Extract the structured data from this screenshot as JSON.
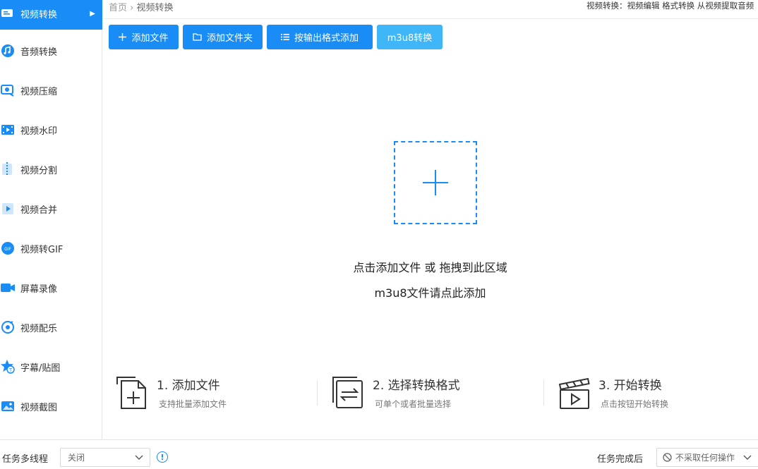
{
  "sidebar": {
    "items": [
      {
        "label": "视频转换",
        "icon": "video-convert-icon",
        "active": true
      },
      {
        "label": "音频转换",
        "icon": "audio-convert-icon"
      },
      {
        "label": "视频压缩",
        "icon": "video-compress-icon"
      },
      {
        "label": "视频水印",
        "icon": "video-watermark-icon"
      },
      {
        "label": "视频分割",
        "icon": "video-split-icon"
      },
      {
        "label": "视频合并",
        "icon": "video-merge-icon"
      },
      {
        "label": "视频转GIF",
        "icon": "video-gif-icon"
      },
      {
        "label": "屏幕录像",
        "icon": "screen-record-icon"
      },
      {
        "label": "视频配乐",
        "icon": "video-music-icon"
      },
      {
        "label": "字幕/贴图",
        "icon": "subtitle-sticker-icon"
      },
      {
        "label": "视频截图",
        "icon": "video-screenshot-icon"
      }
    ],
    "active_arrow": "▶"
  },
  "breadcrumb": {
    "home": "首页",
    "separator": "›",
    "current": "视频转换"
  },
  "top_right_text": "视频转换：视频编辑 格式转换 从视频提取音频",
  "toolbar": {
    "add_file": "添加文件",
    "add_folder": "添加文件夹",
    "add_by_format": "按输出格式添加",
    "m3u8": "m3u8转换"
  },
  "dropzone": {
    "hint_line1": "点击添加文件 或 拖拽到此区域",
    "hint_line2": "m3u8文件请点此添加"
  },
  "steps": [
    {
      "title": "1. 添加文件",
      "subtitle": "支持批量添加文件",
      "icon": "add-file-icon"
    },
    {
      "title": "2. 选择转换格式",
      "subtitle": "可单个或者批量选择",
      "icon": "swap-format-icon"
    },
    {
      "title": "3. 开始转换",
      "subtitle": "点击按钮开始转换",
      "icon": "clapper-play-icon"
    }
  ],
  "footer": {
    "multithread_label": "任务多线程",
    "multithread_value": "关闭",
    "info_symbol": "!",
    "after_label": "任务完成后",
    "after_value": "不采取任何操作"
  },
  "colors": {
    "accent": "#1a8cf5",
    "accent_light": "#3fb6f7"
  }
}
